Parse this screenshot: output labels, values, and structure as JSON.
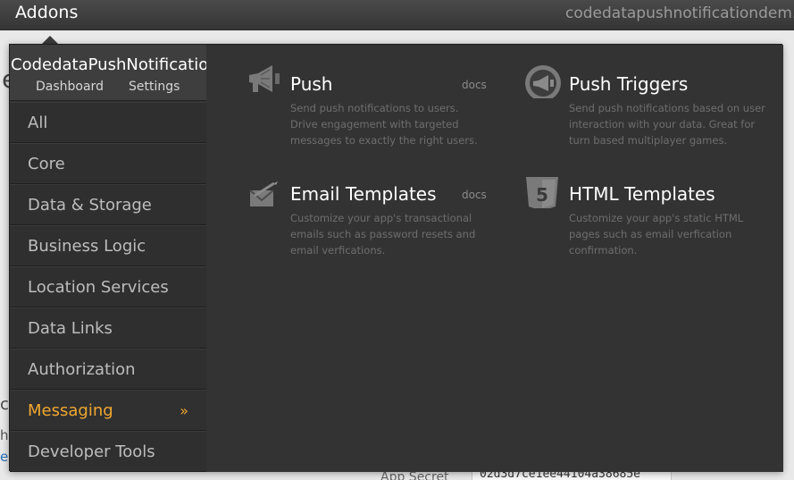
{
  "topbar": {
    "section_title": "Addons",
    "app_name": "codedatapushnotificationdem..."
  },
  "background": {
    "letter_e": "e",
    "letter_c": "c",
    "letter_h": "h",
    "letter_el": "el",
    "app_secret_label": "App Secret",
    "app_secret_value": "02d3d7ce1ee44104a38685e"
  },
  "sidebar": {
    "app_title": "CodedataPushNotificationDemo",
    "dashboard_link": "Dashboard",
    "settings_link": "Settings",
    "items": [
      {
        "label": "All"
      },
      {
        "label": "Core"
      },
      {
        "label": "Data & Storage"
      },
      {
        "label": "Business Logic"
      },
      {
        "label": "Location Services"
      },
      {
        "label": "Data Links"
      },
      {
        "label": "Authorization"
      },
      {
        "label": "Messaging",
        "active": true,
        "chevron": "»"
      },
      {
        "label": "Developer Tools"
      }
    ]
  },
  "addons": [
    {
      "title": "Push",
      "docs": "docs",
      "icon": "megaphone-icon",
      "description": "Send push notifications to users. Drive engagement with targeted messages to exactly the right users."
    },
    {
      "title": "Push Triggers",
      "icon": "megaphone-circle-icon",
      "description": "Send push notifications based on user interaction with your data. Great for turn based multiplayer games."
    },
    {
      "title": "Email Templates",
      "docs": "docs",
      "icon": "envelope-icon",
      "description": "Customize your app's transactional emails such as password resets and email verfications."
    },
    {
      "title": "HTML Templates",
      "icon": "html5-icon",
      "description": "Customize your app's static HTML pages such as email verfication confirmation."
    }
  ],
  "colors": {
    "accent": "#f0a830",
    "panel": "#333333",
    "sidebar": "#2f2f2f"
  }
}
